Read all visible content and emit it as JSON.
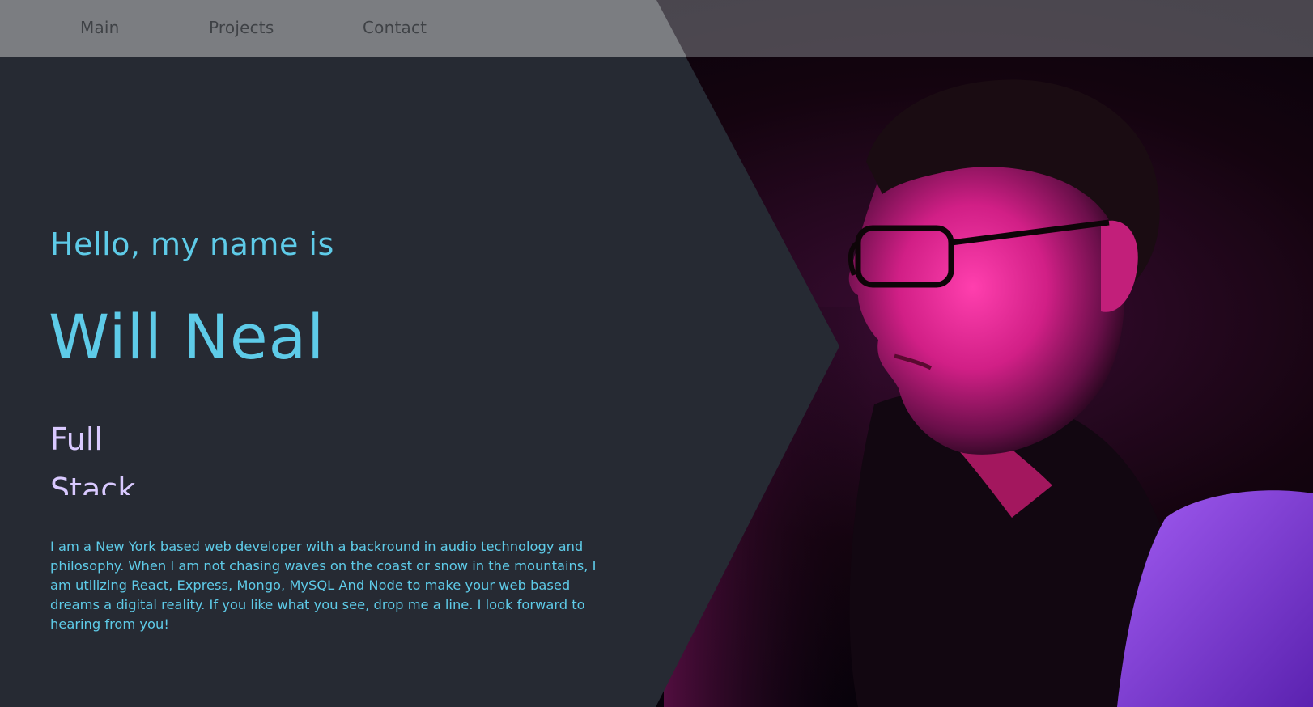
{
  "nav": {
    "items": [
      {
        "label": "Main"
      },
      {
        "label": "Projects"
      },
      {
        "label": "Contact"
      }
    ]
  },
  "hero": {
    "greeting": "Hello, my name is",
    "name": "Will Neal",
    "role_lines": [
      "Full",
      "Stack"
    ],
    "bio": "I am a New York based web developer with a backround in audio technology and philosophy. When I am not chasing waves on the coast or snow in the mountains, I am utilizing React, Express, Mongo, MySQL And Node to make your web based dreams a digital reality. If you like what you see, drop me a line. I look forward to hearing from you!"
  },
  "colors": {
    "accent": "#5ecbe8",
    "role_text": "#d9c9ff",
    "background": "#262a33",
    "nav_bar": "#7b7d81",
    "photo_highlight": "#e0329a",
    "photo_secondary": "#8a3fd6"
  }
}
